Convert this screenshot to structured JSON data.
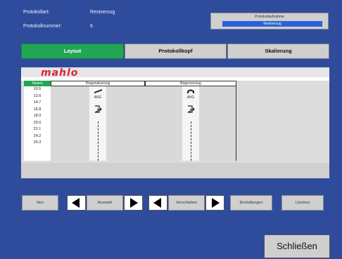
{
  "header": {
    "protokollart_label": "Protokollart:",
    "protokollart_value": "Restverzug",
    "protokollnummer_label": "Protokollnummer:",
    "protokollnummer_value": "6",
    "protokollaufnahme_title": "Protokollaufnahme",
    "protokollaufnahme_value": "Restverzug"
  },
  "tabs": [
    {
      "label": "Layout",
      "active": true
    },
    {
      "label": "Protokollkopf",
      "active": false
    },
    {
      "label": "Skalierung",
      "active": false
    }
  ],
  "logo": "mahlo",
  "scale": {
    "header": "Skalen",
    "values": [
      "10.5",
      "12.6",
      "14.7",
      "16.8",
      "18.9",
      "20.0",
      "22.1",
      "24.2",
      "26.3"
    ]
  },
  "columns": [
    {
      "header": "Diagonalverzug",
      "icon_label": "AVG",
      "icon": "glasses-icon"
    },
    {
      "header": "Bogenverzug",
      "icon_label": "AVG",
      "icon": "arch-icon"
    }
  ],
  "buttons": {
    "neu": "Neu",
    "auswahl": "Auswahl",
    "verschieben": "Verschieben",
    "einstellungen": "Einstellungen",
    "loeschen": "Löschen",
    "schliessen": "Schließen"
  },
  "colors": {
    "background": "#2f4c9c",
    "active_tab": "#22a654",
    "logo": "#d9263a"
  }
}
